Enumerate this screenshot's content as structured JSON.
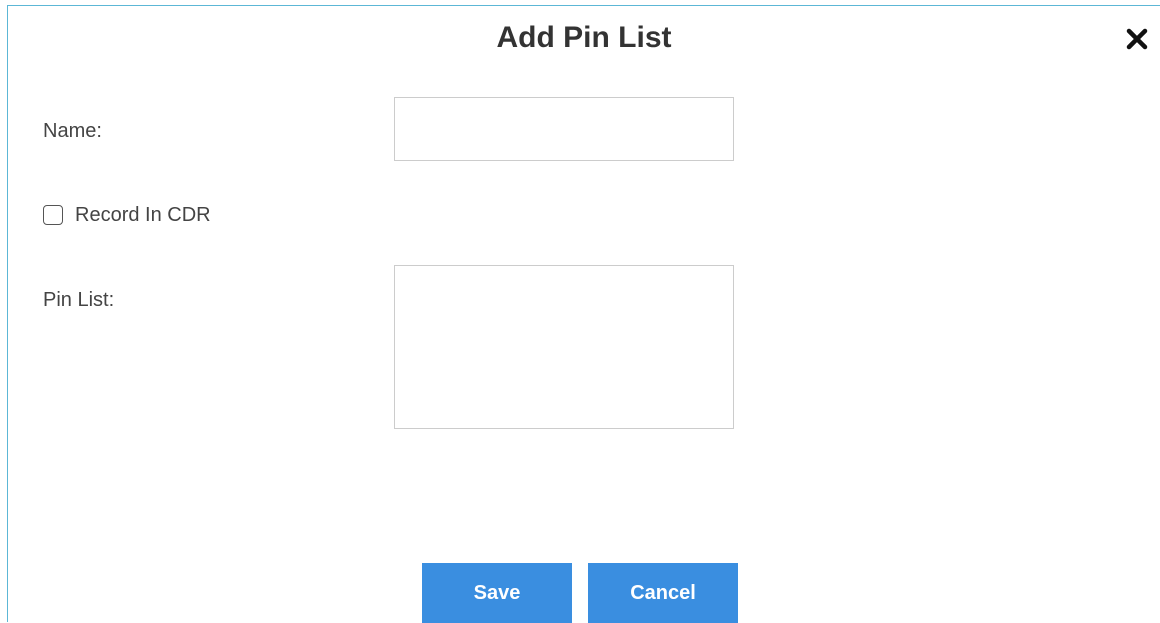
{
  "dialog": {
    "title": "Add Pin List"
  },
  "form": {
    "name_label": "Name:",
    "name_value": "",
    "record_cdr_label": "Record In CDR",
    "record_cdr_checked": false,
    "pin_list_label": "Pin List:",
    "pin_list_value": ""
  },
  "buttons": {
    "save_label": "Save",
    "cancel_label": "Cancel"
  },
  "colors": {
    "accent": "#3a8ee0",
    "border": "#5cb7d6"
  },
  "icons": {
    "close": "close-icon"
  }
}
